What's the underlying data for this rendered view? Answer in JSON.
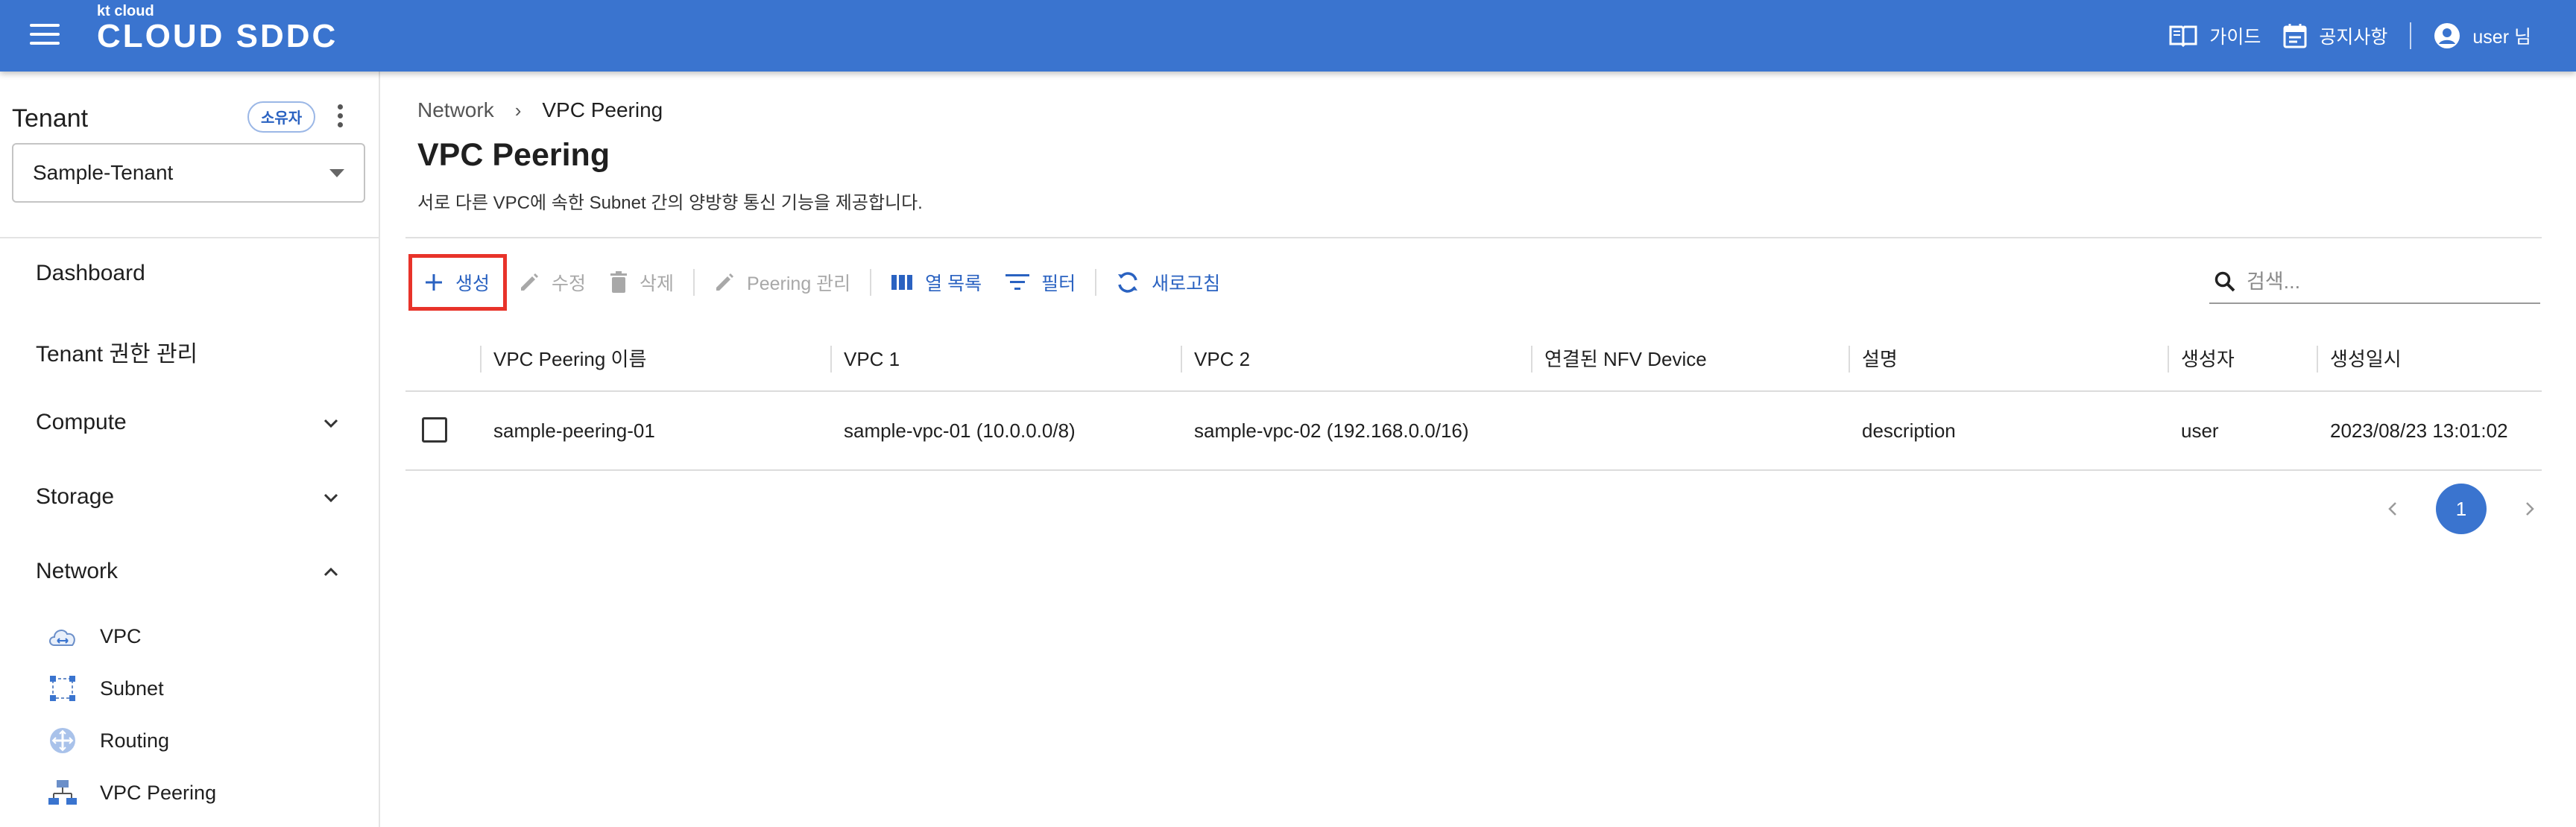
{
  "header": {
    "logo_small": "kt cloud",
    "logo_big": "CLOUD SDDC",
    "guide_label": "가이드",
    "notice_label": "공지사항",
    "user_label": "user 님"
  },
  "sidebar": {
    "tenant_title": "Tenant",
    "owner_badge": "소유자",
    "tenant_selected": "Sample-Tenant",
    "nav": {
      "dashboard": "Dashboard",
      "tenant_admin": "Tenant 권한 관리",
      "compute": "Compute",
      "storage": "Storage",
      "network": "Network"
    },
    "network_items": [
      "VPC",
      "Subnet",
      "Routing",
      "VPC Peering"
    ]
  },
  "breadcrumb": {
    "parent": "Network",
    "current": "VPC Peering"
  },
  "page": {
    "title": "VPC Peering",
    "description": "서로 다른 VPC에 속한 Subnet 간의 양방향 통신 기능을 제공합니다."
  },
  "toolbar": {
    "create": "생성",
    "edit": "수정",
    "delete": "삭제",
    "peering_manage": "Peering 관리",
    "columns": "열 목록",
    "filter": "필터",
    "refresh": "새로고침"
  },
  "search": {
    "placeholder": "검색..."
  },
  "table": {
    "columns": [
      "VPC Peering 이름",
      "VPC 1",
      "VPC 2",
      "연결된 NFV Device",
      "설명",
      "생성자",
      "생성일시"
    ],
    "rows": [
      {
        "name": "sample-peering-01",
        "vpc1": "sample-vpc-01 (10.0.0.0/8)",
        "vpc2": "sample-vpc-02 (192.168.0.0/16)",
        "nfv": "",
        "desc": "description",
        "creator": "user",
        "created": "2023/08/23 13:01:02"
      }
    ]
  },
  "pagination": {
    "current_page": "1"
  },
  "colors": {
    "header_bg": "#3a74cf",
    "accent": "#2a62c1",
    "highlight_border": "#e8332a"
  }
}
